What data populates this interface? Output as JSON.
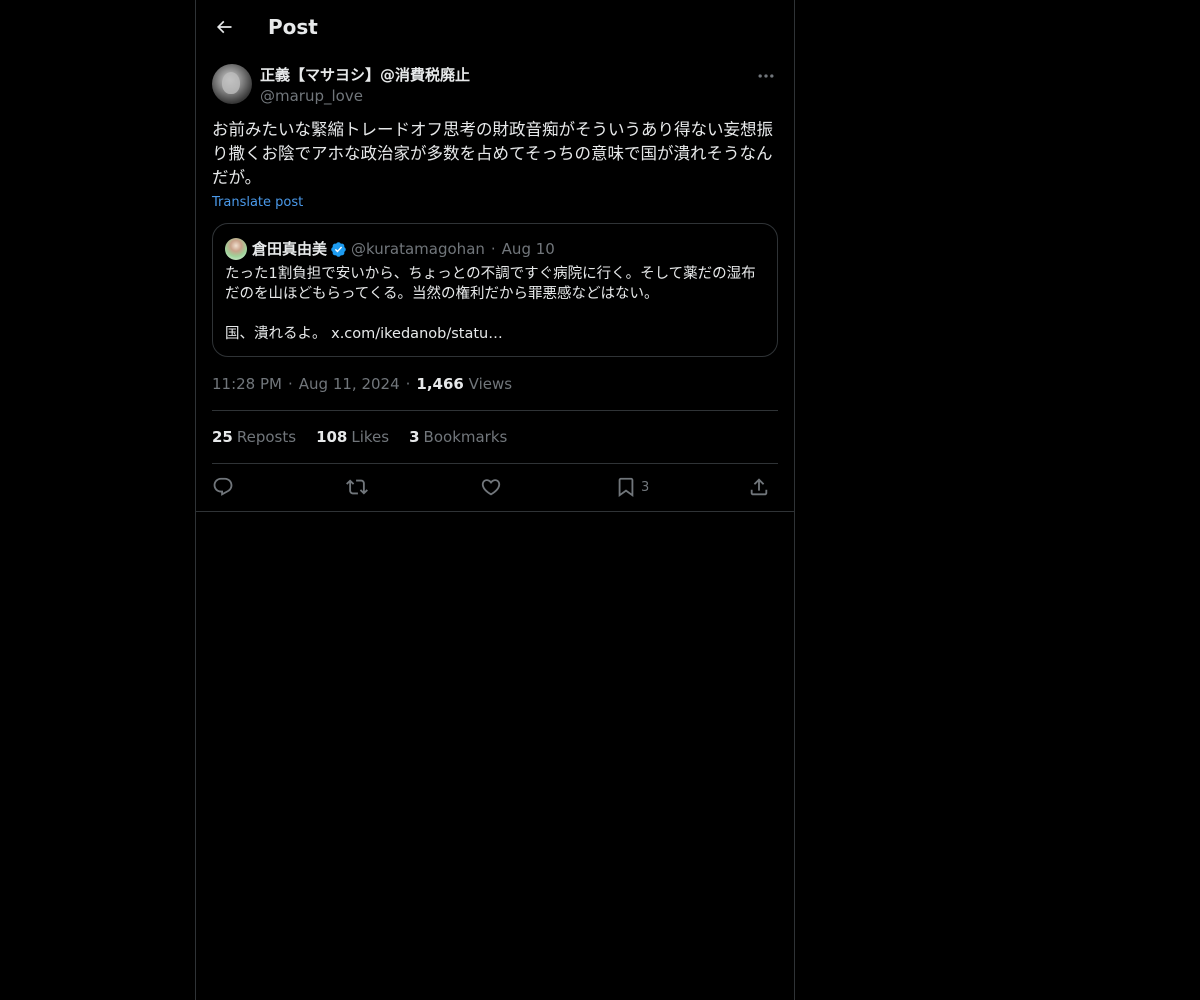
{
  "header": {
    "title": "Post",
    "back_icon": "arrow-left-icon"
  },
  "post": {
    "author": {
      "name": "正義【マサヨシ】@消費税廃止",
      "handle": "@marup_love"
    },
    "text": "お前みたいな緊縮トレードオフ思考の財政音痴がそういうあり得ない妄想振り撒くお陰でアホな政治家が多数を占めてそっちの意味で国が潰れそうなんだが。",
    "translate_label": "Translate post",
    "quote": {
      "name": "倉田真由美",
      "verified": true,
      "handle": "@kuratamagohan",
      "separator": "·",
      "date": "Aug 10",
      "text_paragraph_1": "たった1割負担で安いから、ちょっとの不調ですぐ病院に行く。そして薬だの湿布だのを山ほどもらってくる。当然の権利だから罪悪感などはない。",
      "text_paragraph_2": "国、潰れるよ。 x.com/ikedanob/statu…"
    },
    "meta": {
      "time": "11:28 PM",
      "separator": "·",
      "date": "Aug 11, 2024",
      "views_count": "1,466",
      "views_label": "Views"
    },
    "stats": {
      "reposts_count": "25",
      "reposts_label": "Reposts",
      "likes_count": "108",
      "likes_label": "Likes",
      "bookmarks_count": "3",
      "bookmarks_label": "Bookmarks"
    },
    "actions": {
      "bookmark_count": "3"
    }
  },
  "colors": {
    "background": "#000000",
    "text_primary": "#e7e9ea",
    "text_secondary": "#71767b",
    "border": "#2f3336",
    "link": "#4a99e9",
    "verified": "#1d9bf0"
  }
}
